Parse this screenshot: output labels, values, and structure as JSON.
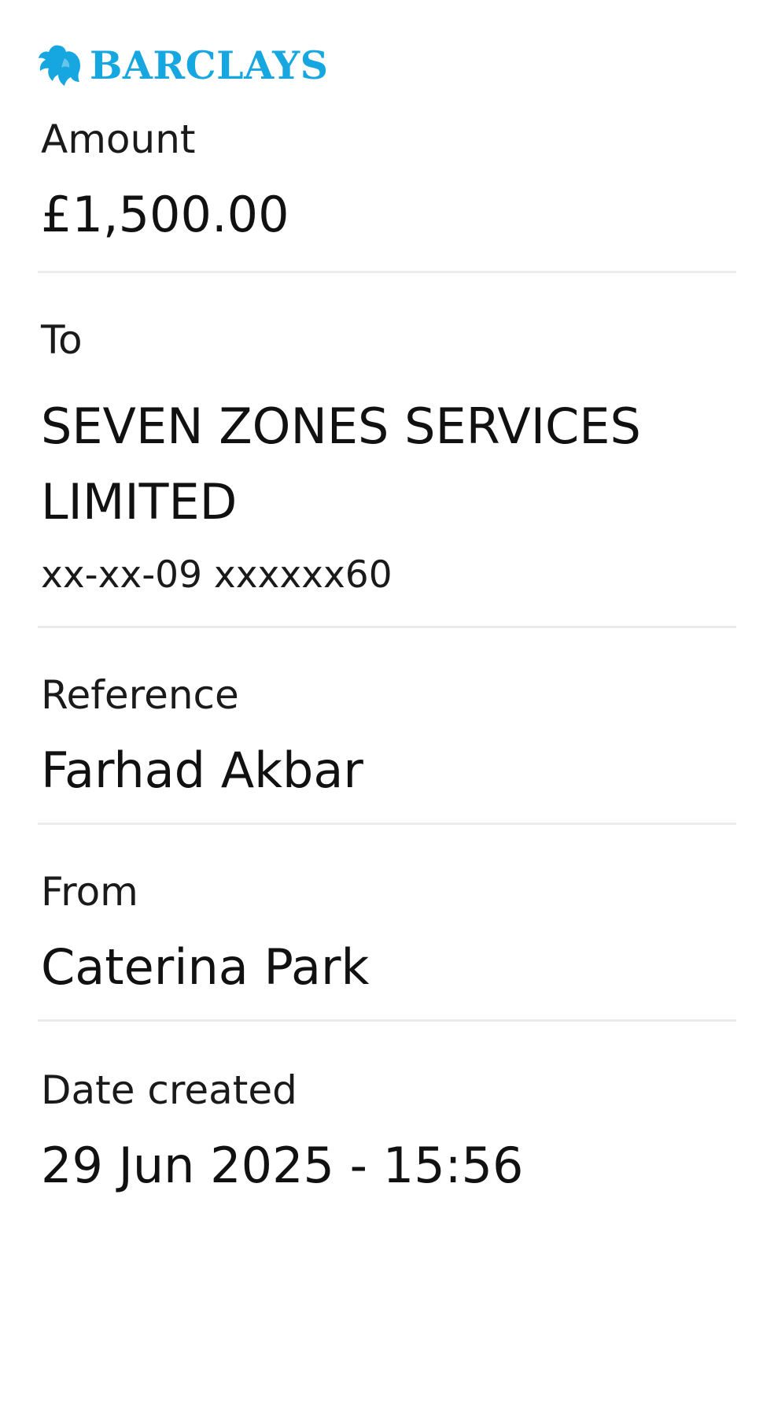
{
  "brand": {
    "name": "BARCLAYS",
    "logo_icon": "eagle-icon",
    "color": "#16a7e0"
  },
  "amount": {
    "label": "Amount",
    "value": "£1,500.00"
  },
  "to": {
    "label": "To",
    "name_line1": "SEVEN ZONES SERVICES",
    "name_line2": "LIMITED",
    "account": "xx-xx-09 xxxxxx60"
  },
  "reference": {
    "label": "Reference",
    "value": "Farhad Akbar"
  },
  "from": {
    "label": "From",
    "value": "Caterina Park"
  },
  "date_created": {
    "label": "Date created",
    "value": "29 Jun 2025 - 15:56"
  }
}
